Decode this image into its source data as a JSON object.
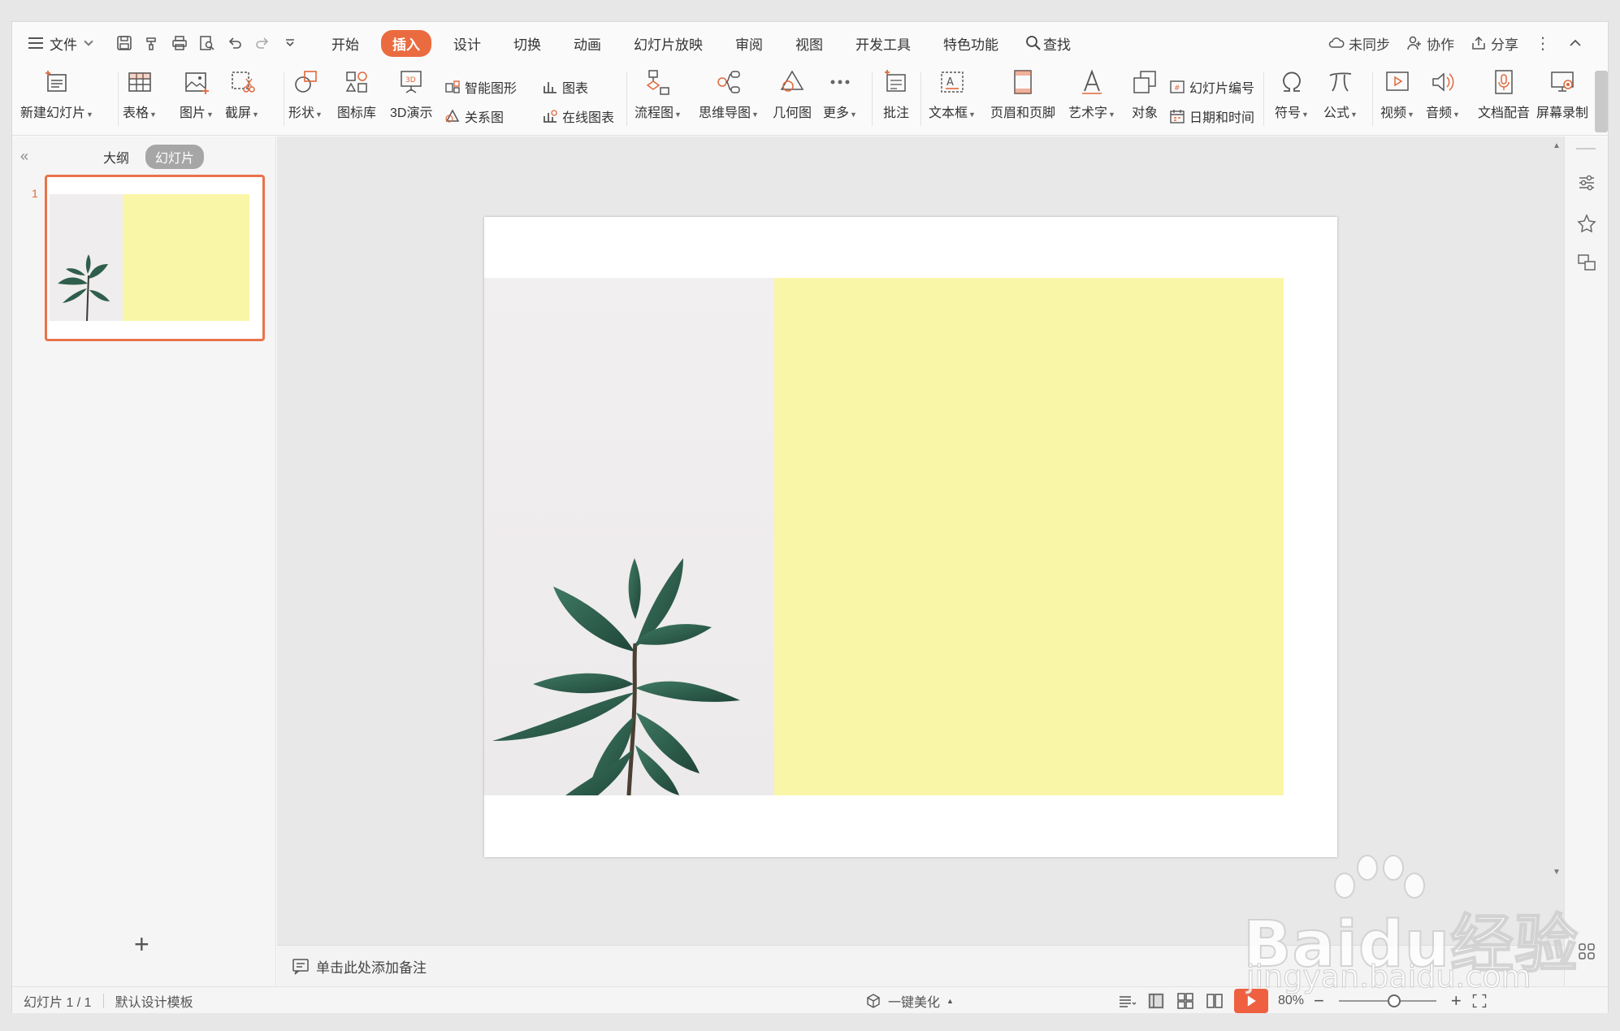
{
  "menu": {
    "file_label": "文件",
    "tabs": [
      "开始",
      "插入",
      "设计",
      "切换",
      "动画",
      "幻灯片放映",
      "审阅",
      "视图",
      "开发工具",
      "特色功能"
    ],
    "active_tab": "插入",
    "search_label": "查找",
    "right": {
      "sync": "未同步",
      "collab": "协作",
      "share": "分享"
    }
  },
  "ribbon": {
    "new_slide": "新建幻灯片",
    "table": "表格",
    "picture": "图片",
    "screenshot": "截屏",
    "shape": "形状",
    "icon_lib": "图标库",
    "demo3d": "3D演示",
    "smart_art": "智能图形",
    "chart": "图表",
    "relation": "关系图",
    "online_chart": "在线图表",
    "flowchart": "流程图",
    "mindmap": "思维导图",
    "geometry": "几何图",
    "more": "更多",
    "comment": "批注",
    "textbox": "文本框",
    "header_footer": "页眉和页脚",
    "wordart": "艺术字",
    "object": "对象",
    "slide_number": "幻灯片编号",
    "datetime": "日期和时间",
    "symbol": "符号",
    "formula": "公式",
    "video": "视频",
    "audio": "音频",
    "doc_voice": "文档配音",
    "screen_record": "屏幕录制"
  },
  "left_panel": {
    "outline": "大纲",
    "slides": "幻灯片",
    "slide_number": "1"
  },
  "notes_placeholder": "单击此处添加备注",
  "status": {
    "slide_count": "幻灯片 1 / 1",
    "template": "默认设计模板",
    "beautify": "一键美化",
    "zoom": "80%"
  },
  "watermark": {
    "brand": "Baidu经验",
    "url": "jingyan.baidu.com"
  },
  "colors": {
    "accent": "#ea6b3f",
    "slide_yellow": "#faf6a8",
    "photo_bg": "#efedee",
    "leaf_green": "#2f5e4c"
  }
}
